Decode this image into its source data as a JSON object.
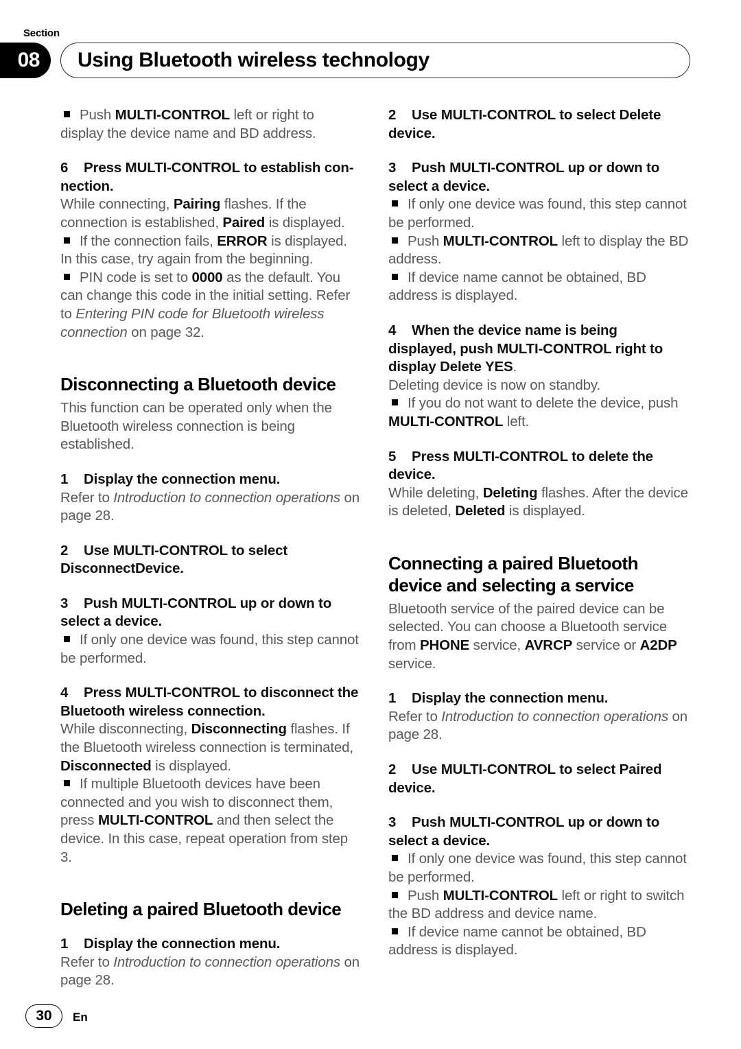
{
  "header": {
    "section_label": "Section",
    "section_number": "08",
    "title": "Using Bluetooth wireless technology"
  },
  "footer": {
    "page_number": "30",
    "language": "En"
  },
  "left_column": {
    "bullet_push_display_name": {
      "prefix": "Push ",
      "bold": "MULTI-CONTROL",
      "suffix": " left or right to display the device name and BD address."
    },
    "step6": {
      "num": "6",
      "text": "Press MULTI-CONTROL to establish con-nection."
    },
    "step6_body": {
      "p1": "While connecting, ",
      "b1": "Pairing",
      "p2": " flashes. If the connection is established, ",
      "b2": "Paired",
      "p3": " is displayed."
    },
    "bullet_error": {
      "p1": "If the connection fails, ",
      "b1": "ERROR",
      "p2": " is displayed. In this case, try again from the beginning."
    },
    "bullet_pin": {
      "p1": "PIN code is set to ",
      "b1": "0000",
      "p2": " as the default. You can change this code in the initial setting. Refer to ",
      "i1": "Entering PIN code for Bluetooth wireless connection",
      "p3": " on page 32."
    },
    "heading_disconnecting": "Disconnecting a Bluetooth device",
    "disconnecting_intro": "This function can be operated only when the Bluetooth wireless connection is being established.",
    "dc_step1": {
      "num": "1",
      "text": "Display the connection menu."
    },
    "dc_step1_body": {
      "p1": "Refer to ",
      "i1": "Introduction to connection operations",
      "p2": " on page 28."
    },
    "dc_step2": {
      "num": "2",
      "text": "Use MULTI-CONTROL to select DisconnectDevice."
    },
    "dc_step3": {
      "num": "3",
      "text": "Push MULTI-CONTROL up or down to select a device."
    },
    "dc_step3_bullet": "If only one device was found, this step cannot be performed.",
    "dc_step4": {
      "num": "4",
      "text": "Press MULTI-CONTROL to disconnect the Bluetooth wireless connection."
    },
    "dc_step4_body": {
      "p1": "While disconnecting, ",
      "b1": "Disconnecting",
      "p2": " flashes. If the Bluetooth wireless connection is terminated, ",
      "b2": "Disconnected",
      "p3": " is displayed."
    },
    "dc_step4_bullet": {
      "p1": "If multiple Bluetooth devices have been connected and you wish to disconnect them, press ",
      "b1": "MULTI-CONTROL",
      "p2": " and then select the device. In this case, repeat operation from step 3."
    },
    "heading_deleting": "Deleting a paired Bluetooth device",
    "del_step1": {
      "num": "1",
      "text": "Display the connection menu."
    },
    "del_step1_body": {
      "p1": "Refer to ",
      "i1": "Introduction to connection operations",
      "p2": " on page 28."
    }
  },
  "right_column": {
    "del_step2": {
      "num": "2",
      "text": "Use MULTI-CONTROL to select Delete device."
    },
    "del_step3": {
      "num": "3",
      "text": "Push MULTI-CONTROL up or down to select a device."
    },
    "del_step3_bullet1": "If only one device was found, this step cannot be performed.",
    "del_step3_bullet2": {
      "p1": "Push ",
      "b1": "MULTI-CONTROL",
      "p2": " left to display the BD address."
    },
    "del_step3_bullet3": "If device name cannot be obtained, BD address is displayed.",
    "del_step4": {
      "num": "4",
      "text": "When the device name is being displayed, push MULTI-CONTROL right to display Delete YES",
      "tail": "."
    },
    "del_step4_body": "Deleting device is now on standby.",
    "del_step4_bullet": {
      "p1": "If you do not want to delete the device, push ",
      "b1": "MULTI-CONTROL",
      "p2": " left."
    },
    "del_step5": {
      "num": "5",
      "text": "Press MULTI-CONTROL to delete the device."
    },
    "del_step5_body": {
      "p1": "While deleting, ",
      "b1": "Deleting",
      "p2": " flashes. After the device is deleted, ",
      "b2": "Deleted",
      "p3": " is displayed."
    },
    "heading_connecting": "Connecting a paired Bluetooth device and selecting a service",
    "connecting_intro": {
      "p1": "Bluetooth service of the paired device can be selected. You can choose a Bluetooth service from ",
      "b1": "PHONE",
      "p2": " service, ",
      "b2": "AVRCP",
      "p3": " service or ",
      "b3": "A2DP",
      "p4": " service."
    },
    "cn_step1": {
      "num": "1",
      "text": "Display the connection menu."
    },
    "cn_step1_body": {
      "p1": "Refer to ",
      "i1": "Introduction to connection operations",
      "p2": " on page 28."
    },
    "cn_step2": {
      "num": "2",
      "text": "Use MULTI-CONTROL to select Paired device."
    },
    "cn_step3": {
      "num": "3",
      "text": "Push MULTI-CONTROL up or down to select a device."
    },
    "cn_step3_bullet1": "If only one device was found, this step cannot be performed.",
    "cn_step3_bullet2": {
      "p1": "Push ",
      "b1": "MULTI-CONTROL",
      "p2": " left or right to switch the BD address and device name."
    },
    "cn_step3_bullet3": "If device name cannot be obtained, BD address is displayed."
  }
}
